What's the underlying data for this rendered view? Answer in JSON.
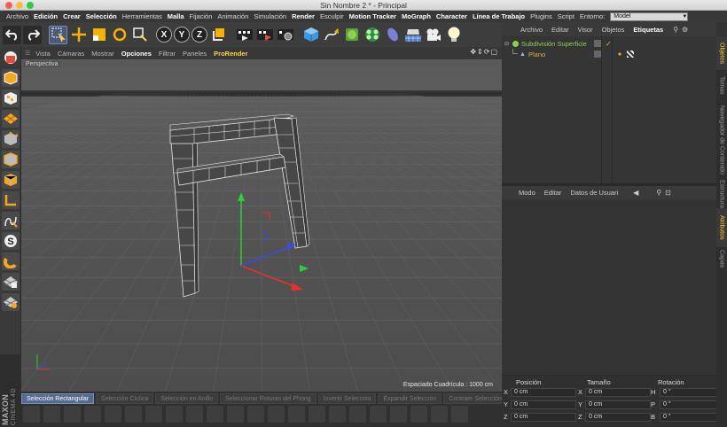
{
  "window": {
    "title": "Sin Nombre 2 * - Principal"
  },
  "menu": {
    "items": [
      "Archivo",
      "Edición",
      "Crear",
      "Selección",
      "Herramientas",
      "Malla",
      "Fijación",
      "Animación",
      "Simulación",
      "Render",
      "Esculpir",
      "Motion Tracker",
      "MoGraph",
      "Character",
      "Línea de Trabajo",
      "Plugins",
      "Script"
    ],
    "bold": [
      false,
      true,
      true,
      true,
      false,
      true,
      false,
      false,
      false,
      true,
      false,
      true,
      true,
      true,
      true,
      false,
      false
    ],
    "env_label": "Entorno:",
    "env_value": "Model"
  },
  "toolbar": {
    "icons": [
      "undo-icon",
      "redo-icon",
      "live-selection-icon",
      "move-icon",
      "scale-icon",
      "rotate-icon",
      "recent-tools-icon",
      "x-axis-icon",
      "y-axis-icon",
      "z-axis-icon",
      "coordinate-system-icon",
      "render-view-icon",
      "render-picture-viewer-icon",
      "edit-render-settings-icon",
      "cube-icon",
      "pen-spline-icon",
      "subdivision-surface-icon",
      "array-icon",
      "deformer-icon",
      "floor-icon",
      "camera-icon",
      "light-icon"
    ],
    "axis_labels": [
      "X",
      "Y",
      "Z"
    ]
  },
  "viewport": {
    "menu": [
      "Vista",
      "Cámaras",
      "Mostrar",
      "Opciones",
      "Filtrar",
      "Paneles",
      "ProRender"
    ],
    "label": "Perspectiva",
    "grid_spacing": "Espaciado Cuadrícula : 1000 cm"
  },
  "selection_modes": [
    "Selección Rectangular",
    "Selección Cíclica",
    "Selección en Anillo",
    "Seleccionar Roturas del Phong",
    "Invertir Selección",
    "Expandir Selección",
    "Contraer Selección"
  ],
  "objects": {
    "menu": [
      "Archivo",
      "Editar",
      "Visor",
      "Objetos",
      "Etiquetas"
    ],
    "items": [
      {
        "name": "Subdivisión Superficie",
        "color": "#8fd14f"
      },
      {
        "name": "Plano",
        "color": "#e8b13a"
      }
    ]
  },
  "attributes": {
    "menu": [
      "Modo",
      "Editar",
      "Datos de Usuari"
    ]
  },
  "coordinates": {
    "headers": [
      "Posición",
      "Tamaño",
      "Rotación"
    ],
    "rows": [
      {
        "pos_label": "X",
        "pos": "0 cm",
        "size_label": "X",
        "size": "0 cm",
        "rot_label": "H",
        "rot": "0 °"
      },
      {
        "pos_label": "Y",
        "pos": "0 cm",
        "size_label": "Y",
        "size": "0 cm",
        "rot_label": "P",
        "rot": "0 °"
      },
      {
        "pos_label": "Z",
        "pos": "0 cm",
        "size_label": "Z",
        "size": "0 cm",
        "rot_label": "B",
        "rot": "0 °"
      }
    ]
  },
  "side_tabs": [
    "Objetos",
    "Tomas",
    "Navegador de Contenido",
    "Estructura",
    "Atributos",
    "Capas"
  ],
  "branding": {
    "maxon": "MAXON",
    "product": "CINEMA 4D"
  }
}
